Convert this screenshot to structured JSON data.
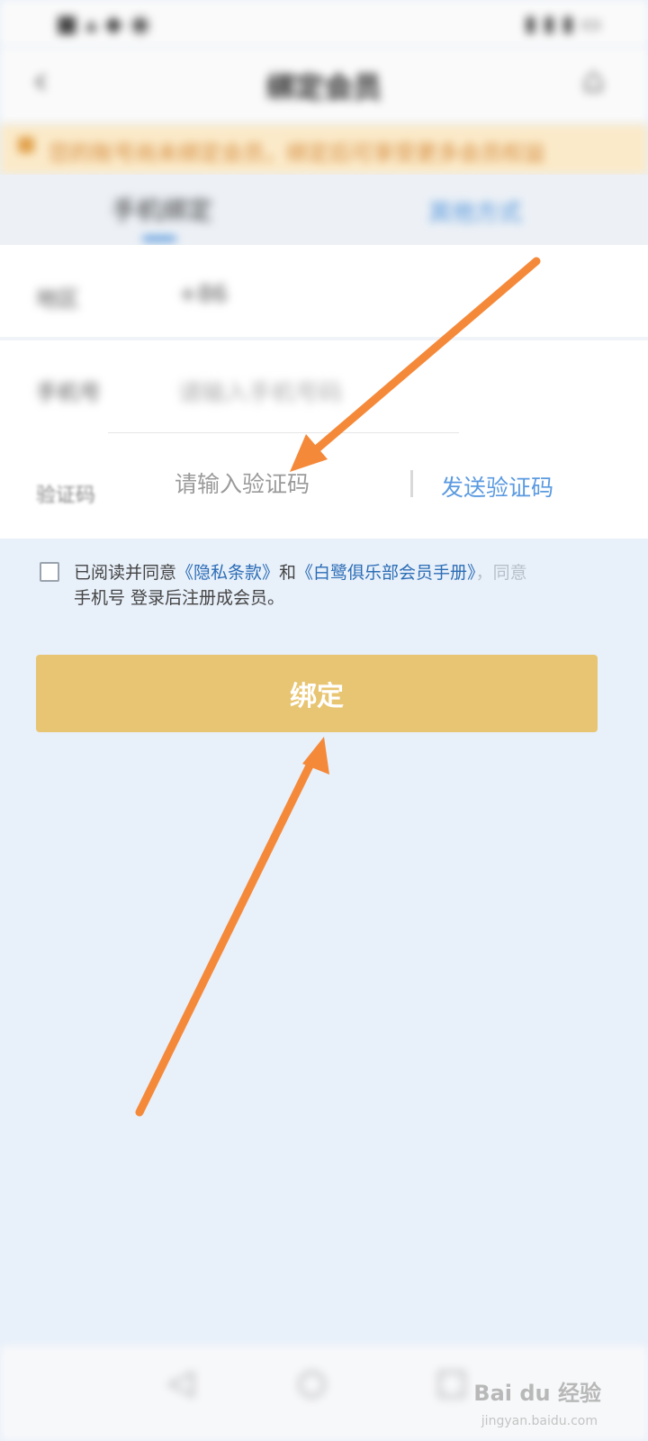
{
  "status_bar": {
    "left": "■ ▴ ◆ ◉",
    "right": "▮ ▮ ▮ ▭"
  },
  "nav": {
    "back_icon": "chevron-left-icon",
    "title": "绑定会员",
    "home_icon": "home-icon"
  },
  "notice": {
    "text": "您的账号尚未绑定会员，绑定后可享受更多会员权益"
  },
  "tabs": {
    "phone": "手机绑定",
    "other": "其他方式"
  },
  "form": {
    "region_label": "地区",
    "region_value": "+86",
    "phone_label": "手机号",
    "phone_placeholder": "请输入手机号码",
    "code_label": "验证码",
    "code_placeholder": "请输入验证码",
    "send_code": "发送验证码"
  },
  "agreement": {
    "prefix": "已阅读并同意",
    "privacy": "《隐私条款》",
    "and": "和",
    "handbook": "《白鹭俱乐部会员手册》",
    "faded": "，同意",
    "suffix": "手机号 登录后注册成会员。"
  },
  "bind_button": "绑定",
  "bottom_nav": {
    "back": "◁",
    "home": "○",
    "recent": "□"
  },
  "watermark": {
    "brand": "Bai du 经验",
    "url": "jingyan.baidu.com"
  },
  "colors": {
    "button": "#e8c572",
    "link": "#2c6db5",
    "arrow": "#f5893a",
    "notice_bg": "#fbeac9"
  }
}
